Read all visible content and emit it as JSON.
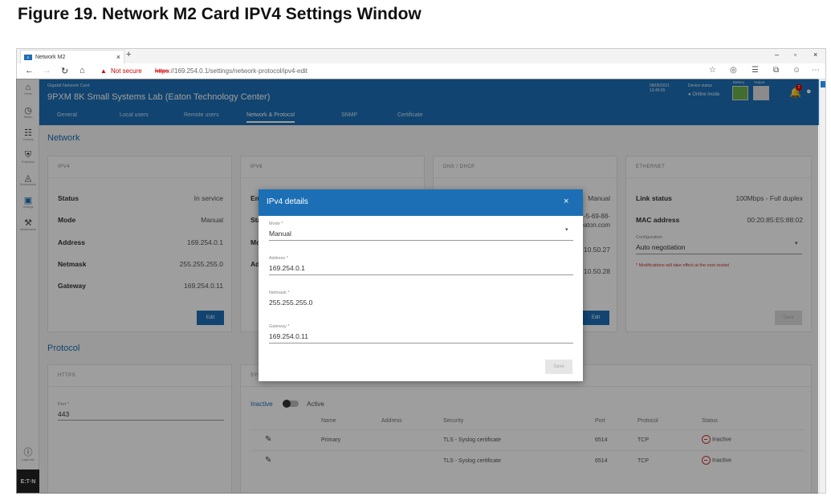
{
  "figure_title": "Figure 19. Network M2 Card IPV4 Settings Window",
  "browser": {
    "tab_title": "Network M2",
    "tab_close": "×",
    "new_tab": "+",
    "minimize": "–",
    "restore": "▫",
    "close": "×",
    "not_secure": "Not secure",
    "url_scheme": "https",
    "url_rest": "://169.254.0.1/settings/network-protocol/ipv4-edit"
  },
  "rail": {
    "items": [
      {
        "icon": "home-icon",
        "label": "Home"
      },
      {
        "icon": "meters-icon",
        "label": "Meters"
      },
      {
        "icon": "controls-icon",
        "label": "Controls"
      },
      {
        "icon": "protection-icon",
        "label": "Protection"
      },
      {
        "icon": "environment-icon",
        "label": "Environment"
      },
      {
        "icon": "settings-icon",
        "label": "Settings"
      },
      {
        "icon": "maintenance-icon",
        "label": "Maintenance"
      }
    ],
    "legal_label": "Legal info",
    "brand": "E:T·N"
  },
  "header": {
    "small": "Gigabit Network Card",
    "title": "9PXM 8K Small Systems Lab (Eaton Technology Center)",
    "tabs": [
      "General",
      "Local users",
      "Remote users",
      "Network & Protocol",
      "SNMP",
      "Certificate"
    ],
    "date": "08/09/2021",
    "time": "13:45:55",
    "device_status": "Device status",
    "online_mode": "● Online mode",
    "battery": "Battery",
    "output": "Output",
    "notif_count": "2"
  },
  "network": {
    "section_title": "Network",
    "ipv4": {
      "title": "IPV4",
      "rows": [
        {
          "label": "Status",
          "value": "In service"
        },
        {
          "label": "Mode",
          "value": "Manual"
        },
        {
          "label": "Address",
          "value": "169.254.0.1"
        },
        {
          "label": "Netmask",
          "value": "255.255.255.0"
        },
        {
          "label": "Gateway",
          "value": "169.254.0.11"
        }
      ],
      "edit": "Edit"
    },
    "ipv6": {
      "title": "IPV6",
      "row1": "En",
      "row2": "Sta",
      "row3": "Mo",
      "row4": "Ad"
    },
    "dns": {
      "title": "DNS / DHCP",
      "v1": "Manual",
      "v2a": "-5-69-88-",
      "v2b": "eaton.com",
      "v3": "10.50.27",
      "v4": "10.50.28",
      "edit": "Edit"
    },
    "ethernet": {
      "title": "ETHERNET",
      "link_status_label": "Link status",
      "link_status_value": "100Mbps - Full duplex",
      "mac_label": "MAC address",
      "mac_value": "00:20:85:E5:88:02",
      "config_label": "Configuration",
      "config_value": "Auto negotiation",
      "note": "* Modifications will take effect at the next restart",
      "save": "Save"
    }
  },
  "protocol": {
    "section_title": "Protocol",
    "https": {
      "title": "HTTPS",
      "port_label": "Port *",
      "port_value": "443"
    },
    "syslog": {
      "title": "SYS",
      "inactive": "Inactive",
      "active": "Active",
      "columns": [
        "Name",
        "Address",
        "Security",
        "Port",
        "Protocol",
        "Status"
      ],
      "rows": [
        {
          "name": "Primary",
          "address": "",
          "security": "TLS - Syslog certificate",
          "port": "6514",
          "protocol": "TCP",
          "status": "Inactive"
        },
        {
          "name": "",
          "address": "",
          "security": "TLS - Syslog certificate",
          "port": "6514",
          "protocol": "TCP",
          "status": "Inactive"
        }
      ]
    }
  },
  "dialog": {
    "title": "IPv4 details",
    "close": "×",
    "mode_label": "Mode *",
    "mode_value": "Manual",
    "address_label": "Address *",
    "address_value": "169.254.0.1",
    "netmask_label": "Netmask *",
    "netmask_value": "255.255.255.0",
    "gateway_label": "Gateway *",
    "gateway_value": "169.254.0.11",
    "save": "Save"
  },
  "colors": {
    "brand_blue": "#1c6fb5",
    "danger": "#cc3333"
  }
}
